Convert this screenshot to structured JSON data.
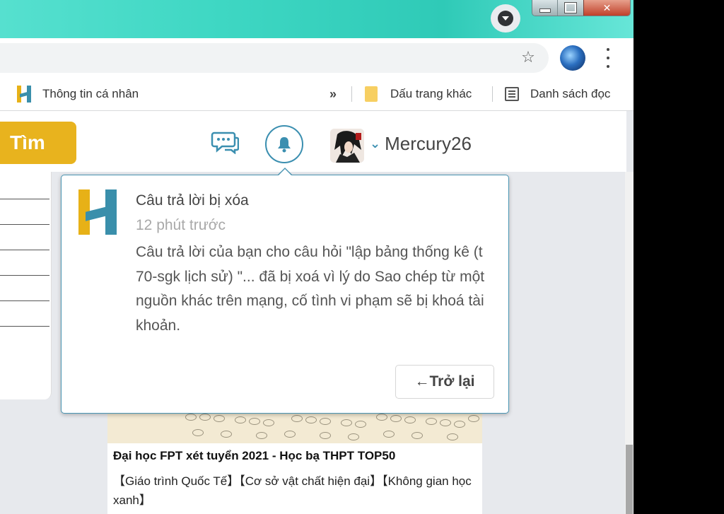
{
  "browser": {
    "bookmarks": {
      "profile_label": "Thông tin cá nhân",
      "overflow_label": "»",
      "other_bookmarks_label": "Dấu trang khác",
      "reading_list_label": "Danh sách đọc"
    }
  },
  "site": {
    "search_button_label": "Tìm",
    "username": "Mercury26"
  },
  "notification": {
    "title": "Câu trả lời bị xóa",
    "time": "12 phút trước",
    "body": "Câu trả lời của bạn cho câu hỏi \"lập bảng thống kê (t 70-sgk lịch sử) \"... đã bị xoá vì lý do Sao chép từ một nguồn khác trên mạng, cố tình vi phạm sẽ bị khoá tài khoản.",
    "back_button_label": "←Trở lại"
  },
  "ad": {
    "title": "Đại học FPT xét tuyển 2021 - Học bạ THPT TOP50",
    "description": "【Giáo trình Quốc Tế】【Cơ sở vật chất hiện đại】【Không gian học xanh】"
  },
  "colors": {
    "brand_yellow": "#e8b31e",
    "brand_blue": "#3a8fab",
    "titlebar_teal": "#3ed7c3"
  },
  "icons": [
    "tab-search-icon",
    "minimize-icon",
    "maximize-icon",
    "close-icon",
    "star-icon",
    "profile-avatar",
    "menu-icon",
    "hoc24-logo-icon",
    "folder-icon",
    "reading-list-icon",
    "chat-icon",
    "bell-icon",
    "chevron-down-icon"
  ]
}
